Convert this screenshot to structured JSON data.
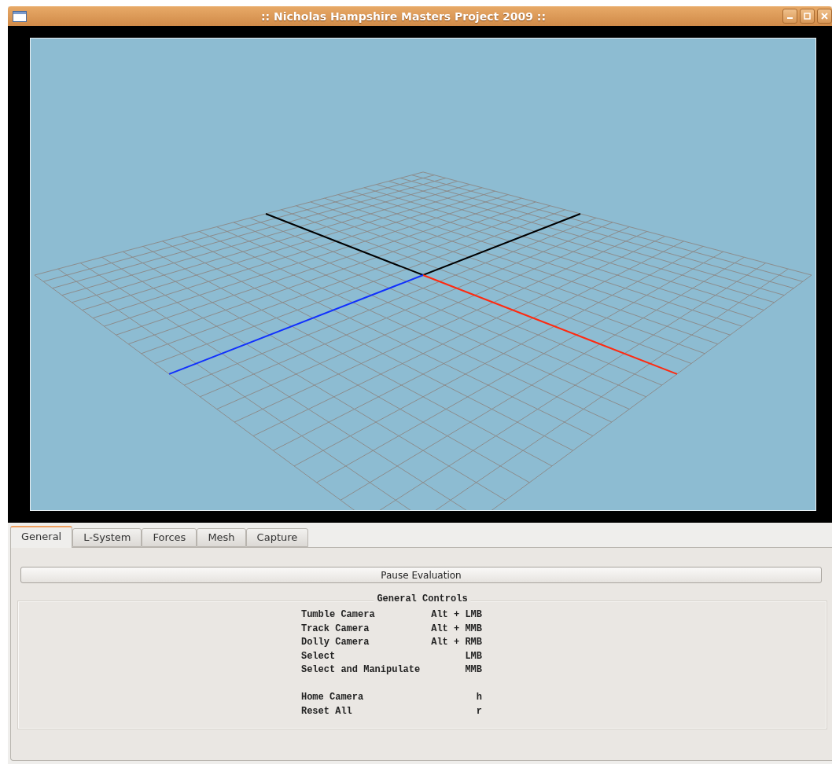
{
  "window": {
    "title": ":: Nicholas Hampshire Masters Project 2009 ::"
  },
  "viewport": {
    "kind": "grid_view"
  },
  "tabs": [
    {
      "label": "General",
      "selected": true
    },
    {
      "label": "L-System",
      "selected": false
    },
    {
      "label": "Forces",
      "selected": false
    },
    {
      "label": "Mesh",
      "selected": false
    },
    {
      "label": "Capture",
      "selected": false
    }
  ],
  "pause_button": {
    "label": "Pause Evaluation"
  },
  "general_controls": {
    "title": "General Controls",
    "groups": [
      [
        {
          "action": "Tumble Camera",
          "shortcut": "Alt + LMB"
        },
        {
          "action": "Track Camera",
          "shortcut": "Alt + MMB"
        },
        {
          "action": "Dolly Camera",
          "shortcut": "Alt + RMB"
        },
        {
          "action": "Select",
          "shortcut": "LMB"
        },
        {
          "action": "Select and Manipulate",
          "shortcut": "MMB"
        }
      ],
      [
        {
          "action": "Home Camera",
          "shortcut": "h"
        },
        {
          "action": "Reset All",
          "shortcut": "r"
        }
      ]
    ]
  }
}
